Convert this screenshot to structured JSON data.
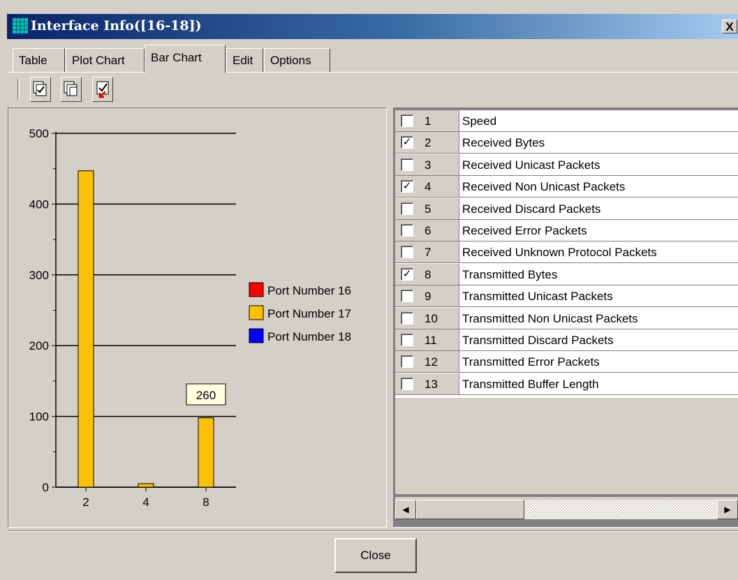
{
  "window": {
    "title": "Interface Info([16-18])",
    "close_glyph": "X"
  },
  "tabs": [
    {
      "label": "Table"
    },
    {
      "label": "Plot Chart"
    },
    {
      "label": "Bar Chart",
      "active": true
    },
    {
      "label": "Edit"
    },
    {
      "label": "Options"
    }
  ],
  "toolbar": {
    "buttons": [
      "select-all-icon",
      "deselect-all-icon",
      "clear-selection-icon"
    ]
  },
  "chart_data": {
    "type": "bar",
    "categories": [
      "2",
      "4",
      "8"
    ],
    "series": [
      {
        "name": "Port Number 16",
        "color": "#ff0000",
        "values": [
          0,
          0,
          0
        ]
      },
      {
        "name": "Port Number 17",
        "color": "#ffc000",
        "values": [
          447,
          5,
          98
        ]
      },
      {
        "name": "Port Number 18",
        "color": "#0000ff",
        "values": [
          0,
          0,
          0
        ]
      }
    ],
    "y_ticks": [
      "0",
      "100",
      "200",
      "300",
      "400",
      "500"
    ],
    "ylim": [
      0,
      500
    ],
    "grid": true,
    "legend": "right",
    "tooltip": "260"
  },
  "table": {
    "rows": [
      {
        "num": "1",
        "name": "Speed",
        "checked": false
      },
      {
        "num": "2",
        "name": "Received Bytes",
        "checked": true
      },
      {
        "num": "3",
        "name": "Received Unicast Packets",
        "checked": false
      },
      {
        "num": "4",
        "name": "Received Non Unicast Packets",
        "checked": true
      },
      {
        "num": "5",
        "name": "Received Discard Packets",
        "checked": false
      },
      {
        "num": "6",
        "name": "Received Error Packets",
        "checked": false
      },
      {
        "num": "7",
        "name": "Received Unknown Protocol Packets",
        "checked": false
      },
      {
        "num": "8",
        "name": "Transmitted Bytes",
        "checked": true
      },
      {
        "num": "9",
        "name": "Transmitted Unicast Packets",
        "checked": false
      },
      {
        "num": "10",
        "name": "Transmitted Non Unicast Packets",
        "checked": false
      },
      {
        "num": "11",
        "name": "Transmitted Discard Packets",
        "checked": false
      },
      {
        "num": "12",
        "name": "Transmitted Error Packets",
        "checked": false
      },
      {
        "num": "13",
        "name": "Transmitted Buffer Length",
        "checked": false
      }
    ]
  },
  "footer": {
    "close_label": "Close"
  }
}
